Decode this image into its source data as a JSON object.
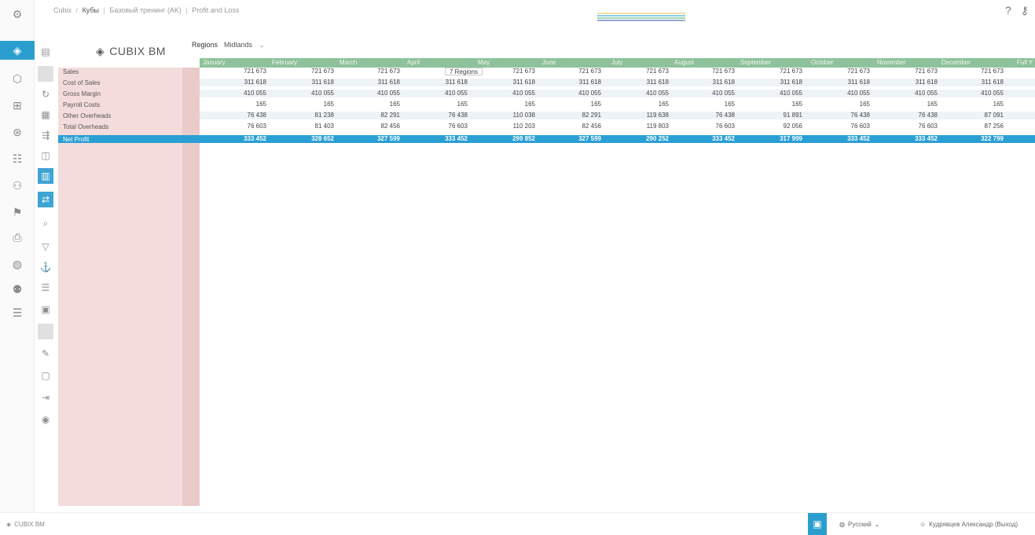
{
  "breadcrumb": {
    "items": [
      "Cubix",
      "Кубы",
      "Базовый тренинг (AK)",
      "Profit and Loss"
    ],
    "separators": [
      "/",
      "|",
      "|"
    ]
  },
  "logo": {
    "text": "CUBIX BM"
  },
  "filter": {
    "label": "Regions",
    "value": "Midlands"
  },
  "tooltip": {
    "text": "7 Regions"
  },
  "months": [
    "January",
    "February",
    "March",
    "April",
    "May",
    "June",
    "July",
    "August",
    "September",
    "October",
    "November",
    "December",
    "Full Y"
  ],
  "rows": [
    {
      "label": "Sales",
      "values": [
        "721 673",
        "721 673",
        "721 673",
        "",
        "721 673",
        "721 673",
        "721 673",
        "721 673",
        "721 673",
        "721 673",
        "721 673",
        "721 673"
      ]
    },
    {
      "label": "Cost of Sales",
      "values": [
        "311 618",
        "311 618",
        "311 618",
        "311 618",
        "311 618",
        "311 618",
        "311 618",
        "311 618",
        "311 618",
        "311 618",
        "311 618",
        "311 618"
      ]
    },
    {
      "label": "Gross Margin",
      "values": [
        "410 055",
        "410 055",
        "410 055",
        "410 055",
        "410 055",
        "410 055",
        "410 055",
        "410 055",
        "410 055",
        "410 055",
        "410 055",
        "410 055"
      ]
    },
    {
      "label": "Payroll Costs",
      "values": [
        "165",
        "165",
        "165",
        "165",
        "165",
        "165",
        "165",
        "165",
        "165",
        "165",
        "165",
        "165"
      ]
    },
    {
      "label": "Other Overheads",
      "values": [
        "76 438",
        "81 238",
        "82 291",
        "76 438",
        "110 038",
        "82 291",
        "119 638",
        "76 438",
        "91 891",
        "76 438",
        "76 438",
        "87 091"
      ]
    },
    {
      "label": "Total Overheads",
      "values": [
        "76 603",
        "81 403",
        "82 456",
        "76 603",
        "110 203",
        "82 456",
        "119 803",
        "76 603",
        "92 056",
        "76 603",
        "76 603",
        "87 256"
      ]
    },
    {
      "label": "Net Profit",
      "values": [
        "333 452",
        "328 652",
        "327 599",
        "333 452",
        "299 852",
        "327 599",
        "290 252",
        "333 452",
        "317 999",
        "333 452",
        "333 452",
        "322 799"
      ]
    }
  ],
  "footer": {
    "logo": "CUBIX BM",
    "language": "Русский",
    "user": "Кудрявцев Александр (Выход)"
  },
  "colors": {
    "accent": "#2a9fcf",
    "header_green": "#8fc29a",
    "row_header_pink": "#f4dcdc",
    "net_profit_row": "#2a9fd4"
  },
  "icons": {
    "rail": [
      "tools-icon",
      "cube-icon",
      "cubes-icon",
      "hierarchy-icon",
      "settings-icon",
      "table-icon",
      "users-icon",
      "network-icon",
      "printer-icon",
      "globe-icon",
      "group-icon",
      "sliders-icon"
    ],
    "toolbar": [
      "pivot-icon",
      "empty-icon",
      "refresh-icon",
      "grid-icon",
      "share-icon",
      "chart-icon",
      "table-blue-icon",
      "swap-icon",
      "search-icon",
      "filter-icon",
      "hierarchy-icon",
      "list-icon",
      "bracket-icon",
      "disabled-icon",
      "bookmark-icon",
      "document-icon",
      "export-icon",
      "help-icon"
    ]
  }
}
